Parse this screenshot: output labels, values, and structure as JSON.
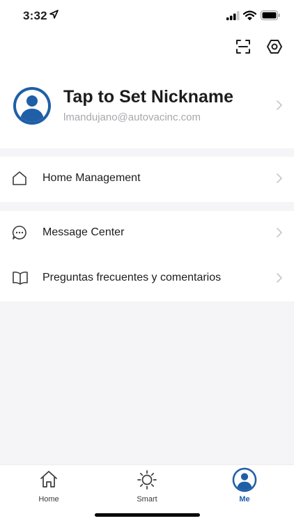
{
  "status_bar": {
    "time": "3:32"
  },
  "profile": {
    "nickname": "Tap to Set Nickname",
    "email": "lmandujano@autovacinc.com"
  },
  "menu": {
    "home_management": "Home Management",
    "message_center": "Message Center",
    "faq": "Preguntas frecuentes y comentarios"
  },
  "tabbar": {
    "home": "Home",
    "smart": "Smart",
    "me": "Me"
  },
  "colors": {
    "accent": "#1f5fa6",
    "background": "#f5f5f7"
  },
  "icons": [
    "location-arrow-icon",
    "signal-icon",
    "wifi-icon",
    "battery-icon",
    "scan-icon",
    "settings-icon",
    "avatar-icon",
    "chevron-right-icon",
    "home-icon",
    "chat-bubble-icon",
    "book-icon",
    "sun-icon"
  ]
}
